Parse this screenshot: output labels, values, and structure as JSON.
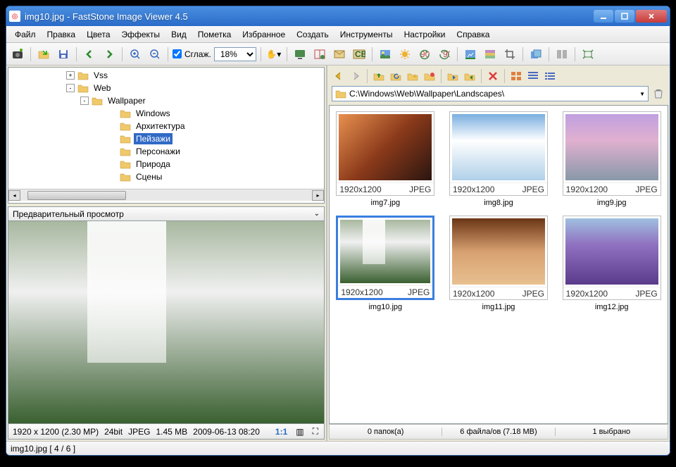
{
  "window": {
    "title": "img10.jpg  -  FastStone Image Viewer 4.5"
  },
  "menu": [
    "Файл",
    "Правка",
    "Цвета",
    "Эффекты",
    "Вид",
    "Пометка",
    "Избранное",
    "Создать",
    "Инструменты",
    "Настройки",
    "Справка"
  ],
  "toolbar": {
    "smooth_label": "Сглаж.",
    "zoom_value": "18%"
  },
  "tree": {
    "items": [
      {
        "indent": 80,
        "expander": "+",
        "label": "Vss"
      },
      {
        "indent": 80,
        "expander": "-",
        "label": "Web"
      },
      {
        "indent": 100,
        "expander": "-",
        "label": "Wallpaper"
      },
      {
        "indent": 140,
        "expander": "",
        "label": "Windows"
      },
      {
        "indent": 140,
        "expander": "",
        "label": "Архитектура"
      },
      {
        "indent": 140,
        "expander": "",
        "label": "Пейзажи",
        "selected": true
      },
      {
        "indent": 140,
        "expander": "",
        "label": "Персонажи"
      },
      {
        "indent": 140,
        "expander": "",
        "label": "Природа"
      },
      {
        "indent": 140,
        "expander": "",
        "label": "Сцены"
      }
    ]
  },
  "preview": {
    "header": "Предварительный просмотр",
    "dims": "1920 x 1200 (2.30 MP)",
    "depth": "24bit",
    "format": "JPEG",
    "size": "1.45 MB",
    "date": "2009-06-13 08:20",
    "ratio": "1:1"
  },
  "path": "C:\\Windows\\Web\\Wallpaper\\Landscapes\\",
  "thumbs": [
    {
      "name": "img7.jpg",
      "res": "1920x1200",
      "fmt": "JPEG",
      "cls": "img-canyon"
    },
    {
      "name": "img8.jpg",
      "res": "1920x1200",
      "fmt": "JPEG",
      "cls": "img-ice"
    },
    {
      "name": "img9.jpg",
      "res": "1920x1200",
      "fmt": "JPEG",
      "cls": "img-beach"
    },
    {
      "name": "img10.jpg",
      "res": "1920x1200",
      "fmt": "JPEG",
      "cls": "img-waterfall",
      "selected": true
    },
    {
      "name": "img11.jpg",
      "res": "1920x1200",
      "fmt": "JPEG",
      "cls": "img-arch"
    },
    {
      "name": "img12.jpg",
      "res": "1920x1200",
      "fmt": "JPEG",
      "cls": "img-lavender"
    }
  ],
  "right_status": {
    "folders": "0 папок(а)",
    "files": "6 файла/ов (7.18 MB)",
    "selected": "1 выбрано"
  },
  "bottom_status": "img10.jpg [ 4 / 6 ]"
}
